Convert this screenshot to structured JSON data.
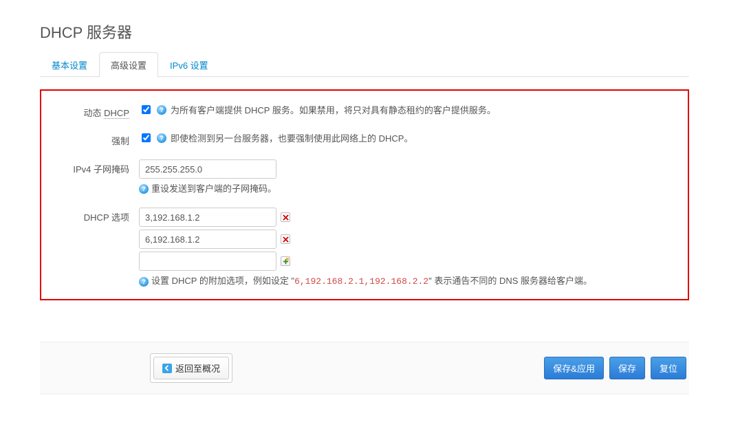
{
  "title": "DHCP 服务器",
  "tabs": {
    "basic": "基本设置",
    "advanced": "高级设置",
    "ipv6": "IPv6 设置"
  },
  "fields": {
    "dyndhcp": {
      "label_pre": "动态 ",
      "label_dotted": "DHCP",
      "checked": true,
      "help": "为所有客户端提供 DHCP 服务。如果禁用，将只对具有静态租约的客户提供服务。"
    },
    "force": {
      "label": "强制",
      "checked": true,
      "help": "即使检测到另一台服务器，也要强制使用此网络上的 DHCP。"
    },
    "netmask": {
      "label": "IPv4 子网掩码",
      "value": "255.255.255.0",
      "help": "重设发送到客户端的子网掩码。"
    },
    "options": {
      "label": "DHCP 选项",
      "items": [
        "3,192.168.1.2",
        "6,192.168.1.2"
      ],
      "help_pre": "设置 DHCP 的附加选项，例如设定 \"",
      "help_code": "6,192.168.2.1,192.168.2.2",
      "help_post": "\" 表示通告不同的 DNS 服务器给客户端。"
    }
  },
  "footer": {
    "back": "返回至概况",
    "save_apply": "保存&应用",
    "save": "保存",
    "reset": "复位"
  }
}
